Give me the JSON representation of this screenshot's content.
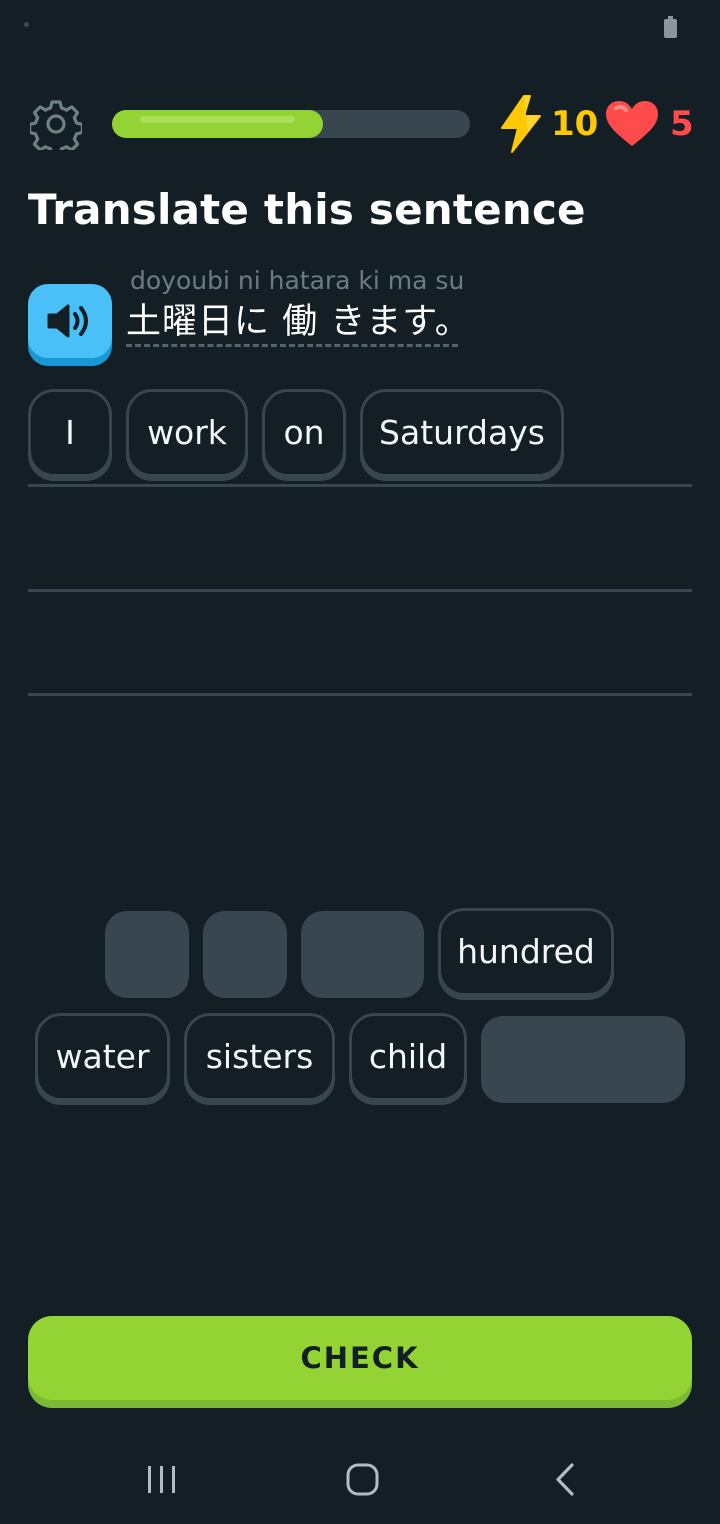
{
  "header": {
    "progress_fraction": 0.59,
    "streak_count": "10",
    "hearts_count": "5",
    "colors": {
      "progress": "#93d333",
      "streak": "#ffc800",
      "hearts": "#ff4b4b"
    }
  },
  "prompt": {
    "title": "Translate this sentence",
    "romaji": "doyoubi ni hatara ki ma su",
    "japanese": "土曜日に 働 きます。"
  },
  "answer_words": [
    "I",
    "work",
    "on",
    "Saturdays"
  ],
  "word_bank": {
    "visible_words": [
      "hundred",
      "water",
      "sisters",
      "child"
    ]
  },
  "check_button": {
    "label": "CHECK"
  },
  "icons": {
    "settings": "gear-icon",
    "streak": "lightning-bolt-icon",
    "hearts": "heart-icon",
    "audio": "speaker-icon"
  }
}
